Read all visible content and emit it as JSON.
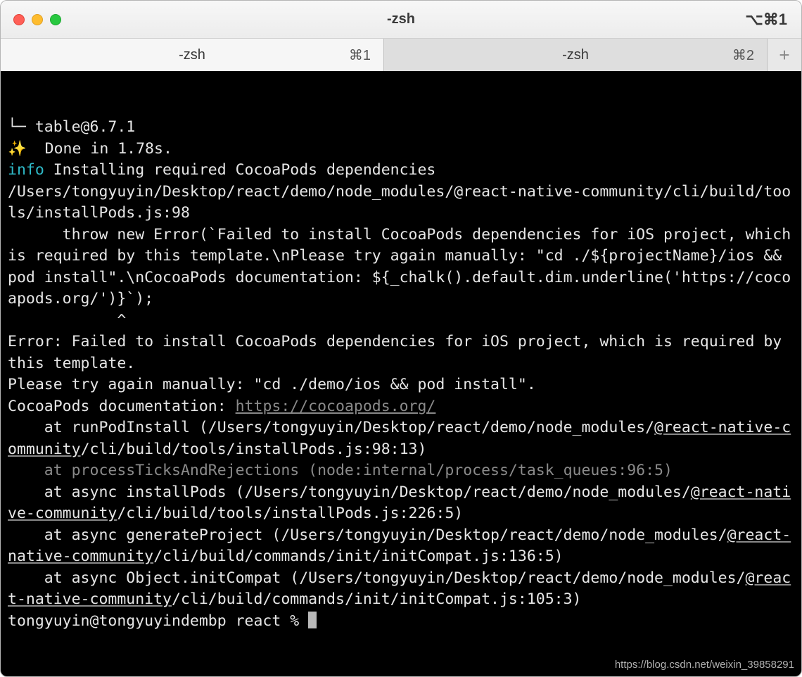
{
  "window": {
    "title": "-zsh",
    "shortcut": "⌥⌘1"
  },
  "tabs": [
    {
      "label": "-zsh",
      "shortcut": "⌘1",
      "active": true
    },
    {
      "label": "-zsh",
      "shortcut": "⌘2",
      "active": false
    }
  ],
  "colors": {
    "info": "#2eb9c7",
    "dim": "#8a8a8a",
    "bg": "#000000",
    "fg": "#e6e6e6"
  },
  "terminal": {
    "lines": [
      {
        "segments": [
          {
            "text": "└─ table@6.7.1"
          }
        ]
      },
      {
        "segments": [
          {
            "text": "✨",
            "cls": "sparkle"
          },
          {
            "text": "  Done in 1.78s."
          }
        ]
      },
      {
        "segments": [
          {
            "text": "info",
            "cls": "info"
          },
          {
            "text": " Installing required CocoaPods dependencies"
          }
        ]
      },
      {
        "segments": [
          {
            "text": "/Users/tongyuyin/Desktop/react/demo/node_modules/@react-native-community/cli/build/tools/installPods.js:98"
          }
        ]
      },
      {
        "segments": [
          {
            "text": "      throw new Error(`Failed to install CocoaPods dependencies for iOS project, which is required by this template.\\nPlease try again manually: \"cd ./${projectName}/ios && pod install\".\\nCocoaPods documentation: ${_chalk().default.dim.underline('https://cocoapods.org/')}`);"
          }
        ]
      },
      {
        "segments": [
          {
            "text": "            ^"
          }
        ]
      },
      {
        "segments": [
          {
            "text": ""
          }
        ]
      },
      {
        "segments": [
          {
            "text": "Error: Failed to install CocoaPods dependencies for iOS project, which is required by this template."
          }
        ]
      },
      {
        "segments": [
          {
            "text": "Please try again manually: \"cd ./demo/ios && pod install\"."
          }
        ]
      },
      {
        "segments": [
          {
            "text": "CocoaPods documentation: "
          },
          {
            "text": "https://cocoapods.org/",
            "cls": "dim uline"
          }
        ]
      },
      {
        "segments": [
          {
            "text": "    at runPodInstall (/Users/tongyuyin/Desktop/react/demo/node_modules/"
          },
          {
            "text": "@react-native-community",
            "cls": "uline"
          },
          {
            "text": "/cli/build/tools/installPods.js:98:13)"
          }
        ]
      },
      {
        "segments": [
          {
            "text": "    at processTicksAndRejections (node:internal/process/task_queues:96:5)",
            "cls": "dim"
          }
        ]
      },
      {
        "segments": [
          {
            "text": "    at async installPods (/Users/tongyuyin/Desktop/react/demo/node_modules/"
          },
          {
            "text": "@react-native-community",
            "cls": "uline"
          },
          {
            "text": "/cli/build/tools/installPods.js:226:5)"
          }
        ]
      },
      {
        "segments": [
          {
            "text": "    at async generateProject (/Users/tongyuyin/Desktop/react/demo/node_modules/"
          },
          {
            "text": "@react-native-community",
            "cls": "uline"
          },
          {
            "text": "/cli/build/commands/init/initCompat.js:136:5)"
          }
        ]
      },
      {
        "segments": [
          {
            "text": "    at async Object.initCompat (/Users/tongyuyin/Desktop/react/demo/node_modules/"
          },
          {
            "text": "@react-native-community",
            "cls": "uline"
          },
          {
            "text": "/cli/build/commands/init/initCompat.js:105:3)"
          }
        ]
      }
    ],
    "prompt": "tongyuyin@tongyuyindembp react % "
  },
  "watermark": "https://blog.csdn.net/weixin_39858291"
}
